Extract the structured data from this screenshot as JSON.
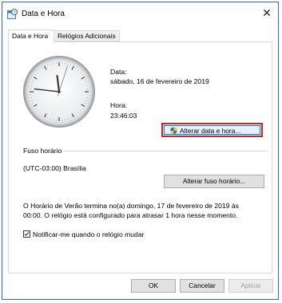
{
  "window": {
    "title": "Data e Hora",
    "close_label": "✕"
  },
  "tabs": [
    "Data e Hora",
    "Relógios Adicionais"
  ],
  "date_time": {
    "date_label": "Data:",
    "date_value": "sábado, 16 de fevereiro de 2019",
    "time_label": "Hora:",
    "time_value": "23:46:03",
    "change_button": "Alterar data e hora..."
  },
  "timezone": {
    "group_label": "Fuso horário",
    "value": "(UTC-03:00) Brasília",
    "change_button": "Alterar fuso horário..."
  },
  "dst_notice": {
    "line1": "O Horário de Verão termina no(a) domingo, 17 de fevereiro de 2019 às",
    "line2": "00:00. O relógio está configurado para atrasar 1 hora nesse momento."
  },
  "notify": {
    "label": "Notificar-me quando o relógio mudar",
    "checked": true
  },
  "footer": {
    "ok": "OK",
    "cancel": "Cancelar",
    "apply": "Aplicar"
  },
  "clock": {
    "hour": 23,
    "minute": 46,
    "second": 3
  }
}
